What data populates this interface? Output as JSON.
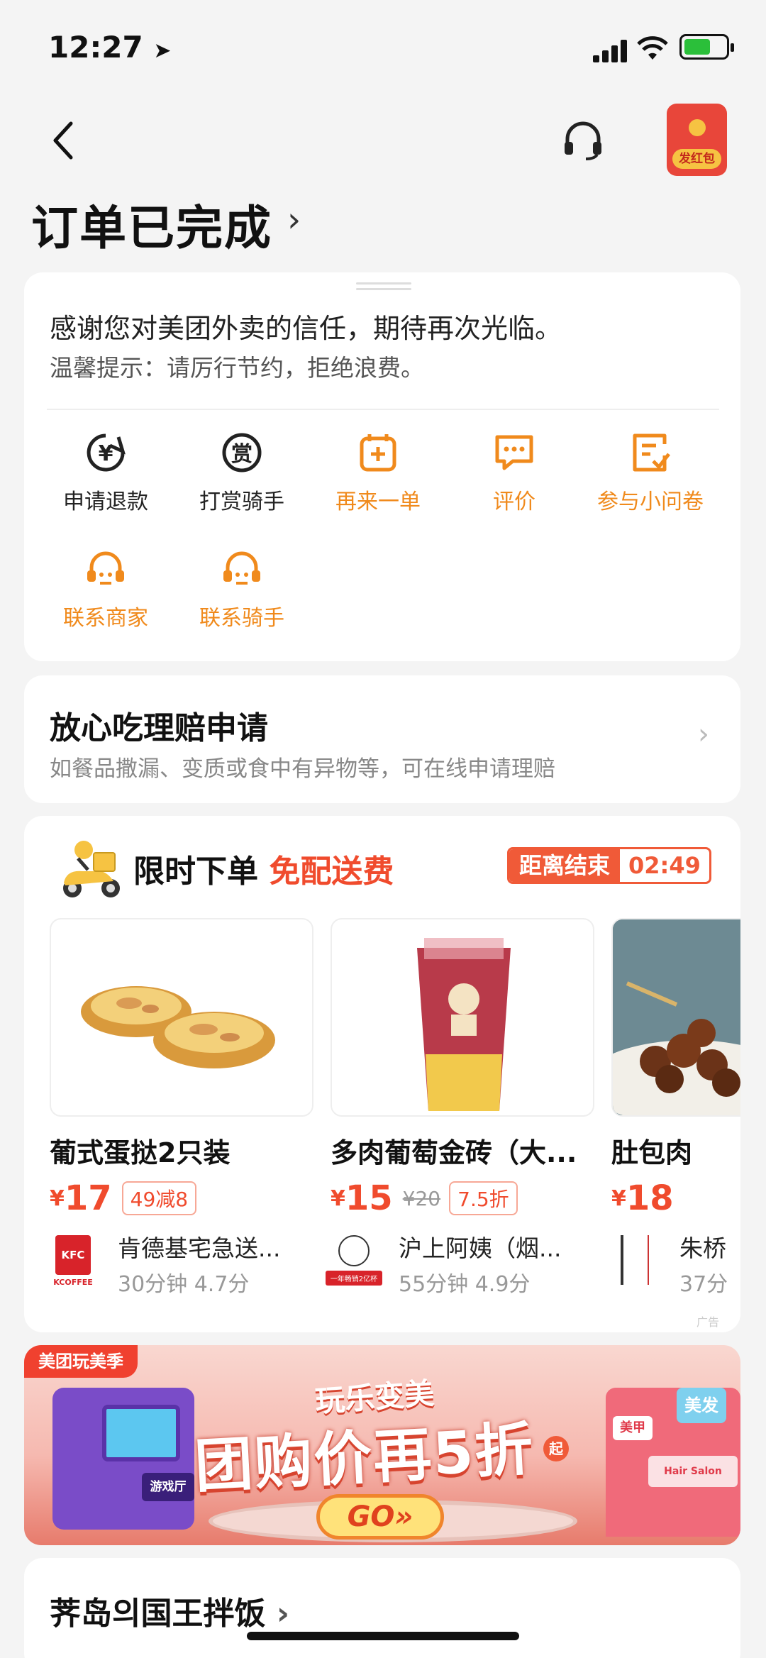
{
  "status": {
    "time": "12:27"
  },
  "header": {
    "title": "订单已完成",
    "title_arrow": "›",
    "red_packet_label": "发红包"
  },
  "order_card": {
    "thanks": "感谢您对美团外卖的信任，期待再次光临。",
    "tip": "温馨提示：请厉行节约，拒绝浪费。",
    "actions": [
      {
        "label": "申请退款",
        "icon": "refund-icon",
        "color": "#222222"
      },
      {
        "label": "打赏骑手",
        "icon": "reward-icon",
        "color": "#222222"
      },
      {
        "label": "再来一单",
        "icon": "reorder-icon",
        "color": "#f08a1c"
      },
      {
        "label": "评价",
        "icon": "review-icon",
        "color": "#f08a1c"
      },
      {
        "label": "参与小问卷",
        "icon": "survey-icon",
        "color": "#f08a1c"
      },
      {
        "label": "联系商家",
        "icon": "contact-merchant-icon",
        "color": "#f08a1c"
      },
      {
        "label": "联系骑手",
        "icon": "contact-rider-icon",
        "color": "#f08a1c"
      }
    ]
  },
  "claim_card": {
    "title": "放心吃理赔申请",
    "subtitle": "如餐品撒漏、变质或食中有异物等，可在线申请理赔"
  },
  "promo": {
    "title": "限时下单",
    "highlight": "免配送费",
    "countdown_label": "距离结束",
    "countdown_time": "02:49",
    "ad_label": "广告",
    "products": [
      {
        "name": "葡式蛋挞2只装",
        "currency": "¥",
        "price": "17",
        "original": "",
        "tag": "49减8",
        "store": "肯德基宅急送...",
        "meta": "30分钟  4.7分",
        "logo_text": "KFC",
        "logo_sub": "KCOFFEE"
      },
      {
        "name": "多肉葡萄金砖（大...",
        "currency": "¥",
        "price": "15",
        "original": "¥20",
        "tag": "7.5折",
        "store": "沪上阿姨（烟...",
        "meta": "55分钟  4.9分",
        "logo_text": "",
        "logo_sub": "一年畅销2亿杯"
      },
      {
        "name": "肚包肉",
        "currency": "¥",
        "price": "18",
        "original": "",
        "tag": "",
        "store": "朱桥",
        "meta": "37分",
        "logo_text": "",
        "logo_sub": ""
      }
    ]
  },
  "banner": {
    "corner": "美团玩美季",
    "sub": "玩乐变美",
    "main": "团购价再5折",
    "qi": "起",
    "go": "GO»",
    "left_sign": "游戏厅",
    "right_sign": "美发",
    "right_sign2": "美甲",
    "shop_sign": "Hair Salon"
  },
  "store_card": {
    "title": "荠岛의国王拌饭",
    "arrow": "›"
  }
}
